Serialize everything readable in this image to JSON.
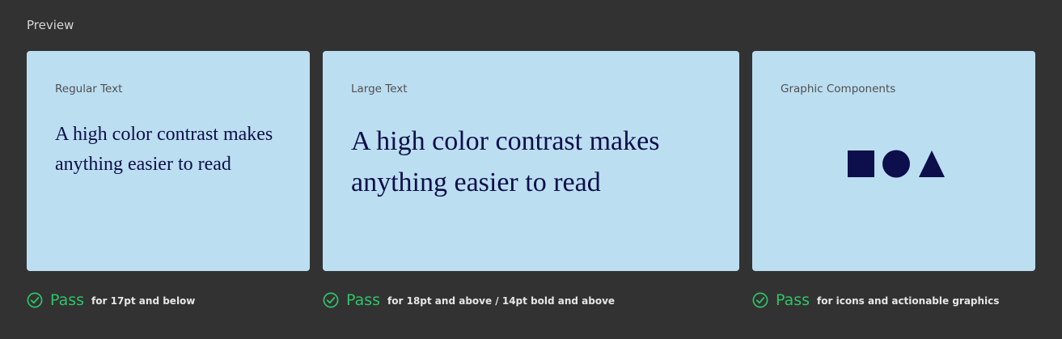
{
  "preview": {
    "title": "Preview"
  },
  "cards": {
    "regular": {
      "label": "Regular Text",
      "sample": "A high color contrast makes anything easier to read"
    },
    "large": {
      "label": "Large Text",
      "sample": "A high color contrast makes anything easier to read"
    },
    "graphic": {
      "label": "Graphic Components",
      "shapes": [
        "square-icon",
        "circle-icon",
        "triangle-icon"
      ]
    }
  },
  "results": {
    "regular": {
      "status": "Pass",
      "note": "for 17pt and below"
    },
    "large": {
      "status": "Pass",
      "note": "for 18pt and above / 14pt bold and above"
    },
    "graphic": {
      "status": "Pass",
      "note": "for icons and actionable graphics"
    }
  },
  "colors": {
    "background": "#323232",
    "card": "#bcdef1",
    "sample_text": "#0c0f4b",
    "pass": "#2fc467"
  }
}
